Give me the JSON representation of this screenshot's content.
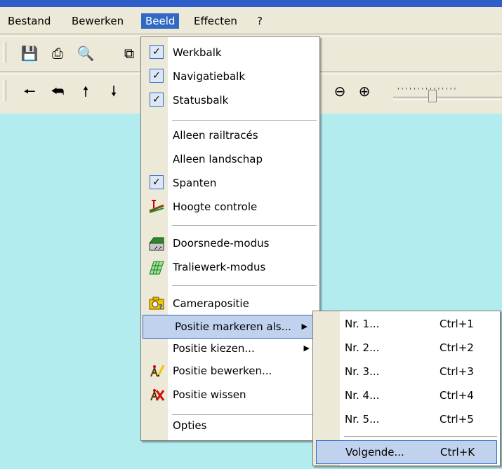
{
  "menubar": {
    "items": [
      "Bestand",
      "Bewerken",
      "Beeld",
      "Effecten",
      "?"
    ]
  },
  "toolbar1": {
    "icons": [
      "save-icon",
      "print-icon",
      "print-preview-icon",
      "copy-icon"
    ]
  },
  "toolbar2": {
    "icons": [
      "arrow-left-icon",
      "arrow-back-icon",
      "arrow-up-icon",
      "arrow-down-icon",
      "zoom-out-icon",
      "zoom-in-icon"
    ],
    "zoom_slider": {
      "value": 0.35
    }
  },
  "view_menu": {
    "items": [
      {
        "label": "Werkbalk",
        "checked": true
      },
      {
        "label": "Navigatiebalk",
        "checked": true
      },
      {
        "label": "Statusbalk",
        "checked": true
      },
      {
        "label": "Alleen railtracés"
      },
      {
        "label": "Alleen landschap"
      },
      {
        "label": "Spanten",
        "checked": true
      },
      {
        "label": "Hoogte controle",
        "icon": "height-check-icon"
      },
      {
        "label": "Doorsnede-modus",
        "icon": "cross-section-icon"
      },
      {
        "label": "Traliewerk-modus",
        "icon": "lattice-icon"
      },
      {
        "label": "Camerapositie",
        "icon": "camera-icon"
      },
      {
        "label": "Positie markeren als...",
        "submenu": true,
        "highlighted": true
      },
      {
        "label": "Positie kiezen...",
        "submenu": true
      },
      {
        "label": "Positie bewerken...",
        "icon": "edit-position-icon"
      },
      {
        "label": "Positie wissen",
        "icon": "delete-position-icon"
      },
      {
        "label": "Opties"
      }
    ]
  },
  "submenu": {
    "items": [
      {
        "label": "Nr. 1...",
        "shortcut": "Ctrl+1"
      },
      {
        "label": "Nr. 2...",
        "shortcut": "Ctrl+2"
      },
      {
        "label": "Nr. 3...",
        "shortcut": "Ctrl+3"
      },
      {
        "label": "Nr. 4...",
        "shortcut": "Ctrl+4"
      },
      {
        "label": "Nr. 5...",
        "shortcut": "Ctrl+5"
      },
      {
        "label": "Volgende...",
        "shortcut": "Ctrl+K",
        "highlighted": true
      }
    ]
  },
  "colors": {
    "accent": "#316ac5",
    "canvas": "#b3ecef",
    "highlight": "#c1d2ee"
  }
}
